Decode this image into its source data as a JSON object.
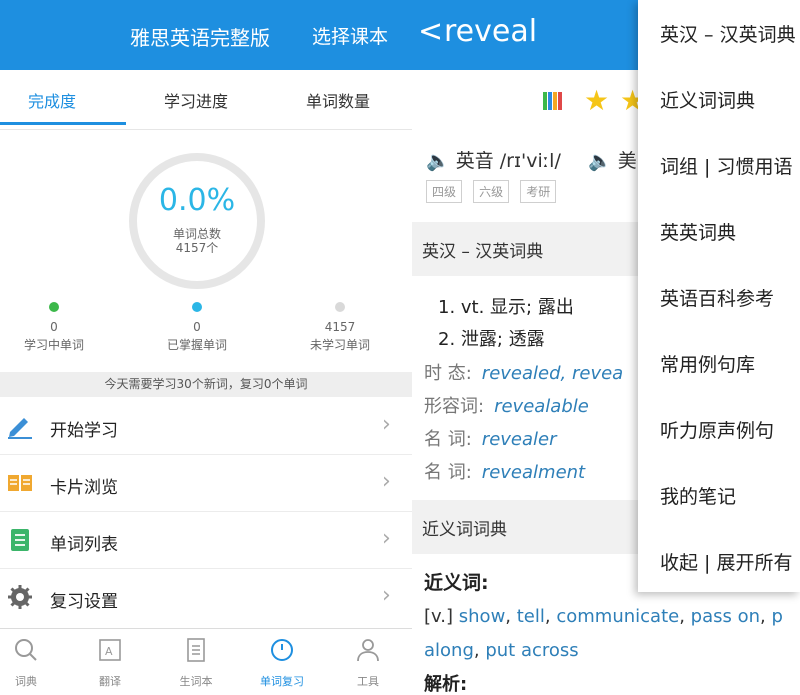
{
  "left": {
    "header": {
      "title": "雅思英语完整版",
      "select_label": "选择课本"
    },
    "tabs": [
      "完成度",
      "学习进度",
      "单词数量"
    ],
    "progress": {
      "percent": "0.0%",
      "label": "单词总数",
      "total": "4157个"
    },
    "stats": [
      {
        "value": "0",
        "label": "学习中单词",
        "color": "#3cb84a"
      },
      {
        "value": "0",
        "label": "已掌握单词",
        "color": "#2bb6e6"
      },
      {
        "value": "4157",
        "label": "未学习单词",
        "color": "#d9d9d9"
      }
    ],
    "notice": "今天需要学习30个新词，复习0个单词",
    "menu": [
      {
        "label": "开始学习",
        "icon": "pencil-icon"
      },
      {
        "label": "卡片浏览",
        "icon": "book-icon"
      },
      {
        "label": "单词列表",
        "icon": "list-icon"
      },
      {
        "label": "复习设置",
        "icon": "gear-icon"
      }
    ],
    "bottom_nav": [
      {
        "label": "词典",
        "icon": "search-icon"
      },
      {
        "label": "翻译",
        "icon": "translate-icon"
      },
      {
        "label": "生词本",
        "icon": "notebook-icon"
      },
      {
        "label": "单词复习",
        "icon": "clock-icon"
      },
      {
        "label": "工具",
        "icon": "user-icon"
      }
    ]
  },
  "right": {
    "header": {
      "back": "<",
      "word": "reveal"
    },
    "pron_uk": "英音 /rɪ'viːl/",
    "pron_us": "美",
    "tags": [
      "四级",
      "六级",
      "考研"
    ],
    "section1": "英汉 – 汉英词典",
    "defs": [
      "1. vt. 显示; 露出",
      "2. 泄露; 透露"
    ],
    "forms": [
      {
        "label": "时 态:",
        "value": "revealed, revea"
      },
      {
        "label": "形容词:",
        "value": "revealable"
      },
      {
        "label": "名 词:",
        "value": "revealer"
      },
      {
        "label": "名 词:",
        "value": "revealment"
      }
    ],
    "section2": "近义词词典",
    "syn_title": "近义词:",
    "syn_prefix": "[v.]",
    "syn_line1_words": [
      "show",
      "tell",
      "communicate",
      "pass on",
      "p"
    ],
    "syn_line2_words": [
      "along",
      "put across"
    ],
    "analysis": "解析:"
  },
  "dropdown": [
    "英汉 – 汉英词典",
    "近义词词典",
    "词组 | 习惯用语",
    "英英词典",
    "英语百科参考",
    "常用例句库",
    "听力原声例句",
    "我的笔记",
    "收起 | 展开所有"
  ],
  "colors": {
    "accent": "#1e8fe0"
  }
}
